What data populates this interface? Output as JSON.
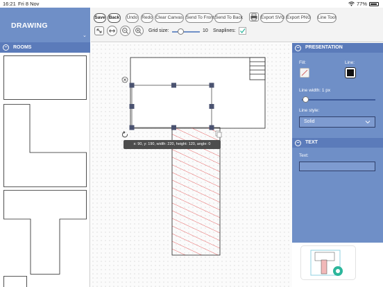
{
  "status_bar": {
    "time": "16:21",
    "date": "Fri 8 Nov",
    "battery": "77%"
  },
  "sidebar": {
    "title": "DRAWING",
    "caret": "⌄",
    "rooms_section": {
      "label": "ROOMS",
      "toggle": "−"
    },
    "room_shapes": [
      "rectangle",
      "l-shape",
      "t-shape",
      "square"
    ]
  },
  "toolbar": {
    "buttons": {
      "save": "Save",
      "back": "Back",
      "undo": "Undo",
      "redo": "Redo",
      "clear_canvas": "Clear Canvas",
      "send_to_front": "Send To Front",
      "send_to_back": "Send To Back",
      "export_svg": "Export SVG",
      "export_png": "Export PNG",
      "line_tool": "Line Tool"
    },
    "icons": [
      "printer-icon",
      "resize-diagonal-icon",
      "resize-horizontal-icon",
      "zoom-out-icon",
      "zoom-in-icon"
    ],
    "grid_size": {
      "label": "Grid size:",
      "value": "10",
      "fraction": 0.3
    },
    "snaplines": {
      "label": "Snaplines:",
      "checked": true
    }
  },
  "canvas": {
    "selection_info": "x: 90, y: 190, width: 220, height: 120, angle: 0"
  },
  "right_panel": {
    "presentation_section": {
      "label": "PRESENTATION",
      "toggle": "−"
    },
    "fill_label": "Fill:",
    "line_label": "Line:",
    "line_width": {
      "label": "Line width:  1 px",
      "fraction": 0.05
    },
    "line_style": {
      "label": "Line style:",
      "value": "Solid"
    },
    "text_section": {
      "label": "TEXT",
      "toggle": "−"
    },
    "text_label": "Text:",
    "text_value": ""
  },
  "colors": {
    "header_blue": "#6f8fc7",
    "section_blue": "#5b7bba",
    "hatch_red": "#e23b3b",
    "handle": "#4a5270",
    "minimap_fab": "#2cb69b"
  }
}
